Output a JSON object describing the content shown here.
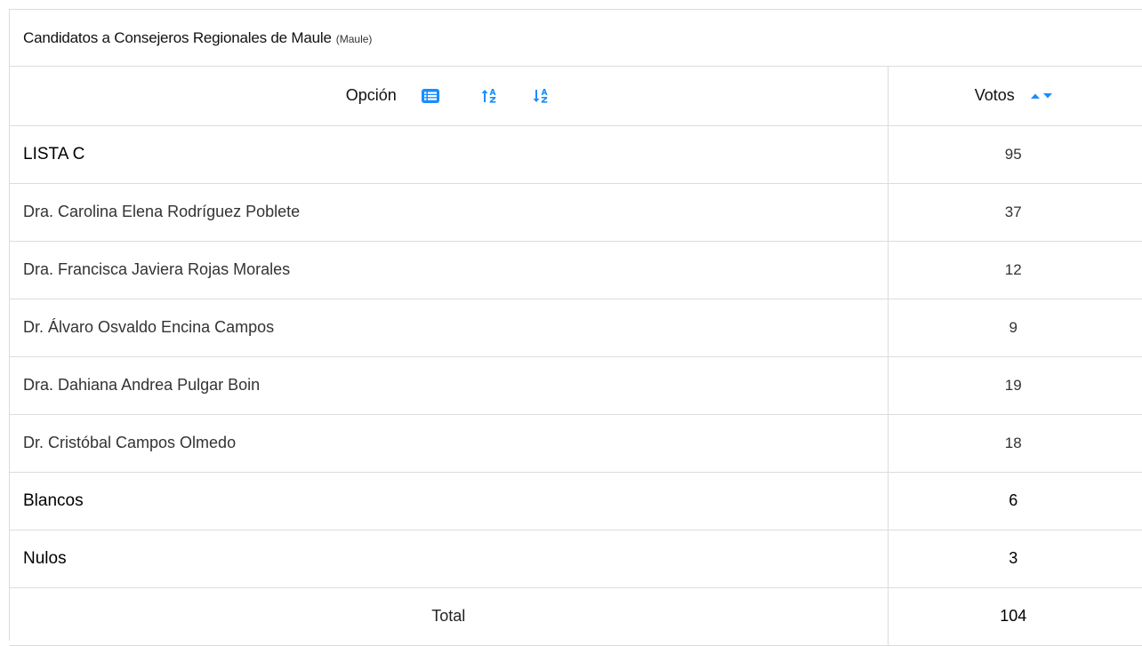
{
  "title": {
    "main": "Candidatos a Consejeros Regionales de Maule",
    "sub": "(Maule)"
  },
  "header": {
    "option_label": "Opción",
    "votes_label": "Votos"
  },
  "icons": {
    "list": "list-icon",
    "sort_az": "sort-alpha-asc-icon",
    "sort_za": "sort-alpha-desc-icon",
    "caret_up": "caret-up-icon",
    "caret_down": "caret-down-icon"
  },
  "accent_color": "#1a8cff",
  "rows": [
    {
      "option": "LISTA C",
      "votes": "95",
      "emphasis": true
    },
    {
      "option": "Dra. Carolina Elena Rodríguez Poblete",
      "votes": "37",
      "emphasis": false
    },
    {
      "option": "Dra. Francisca Javiera Rojas Morales",
      "votes": "12",
      "emphasis": false
    },
    {
      "option": "Dr. Álvaro Osvaldo Encina Campos",
      "votes": "9",
      "emphasis": false
    },
    {
      "option": "Dra. Dahiana Andrea Pulgar Boin",
      "votes": "19",
      "emphasis": false
    },
    {
      "option": "Dr. Cristóbal Campos Olmedo",
      "votes": "18",
      "emphasis": false
    },
    {
      "option": "Blancos",
      "votes": "6",
      "emphasis": true
    },
    {
      "option": "Nulos",
      "votes": "3",
      "emphasis": true
    }
  ],
  "total": {
    "label": "Total",
    "votes": "104"
  }
}
